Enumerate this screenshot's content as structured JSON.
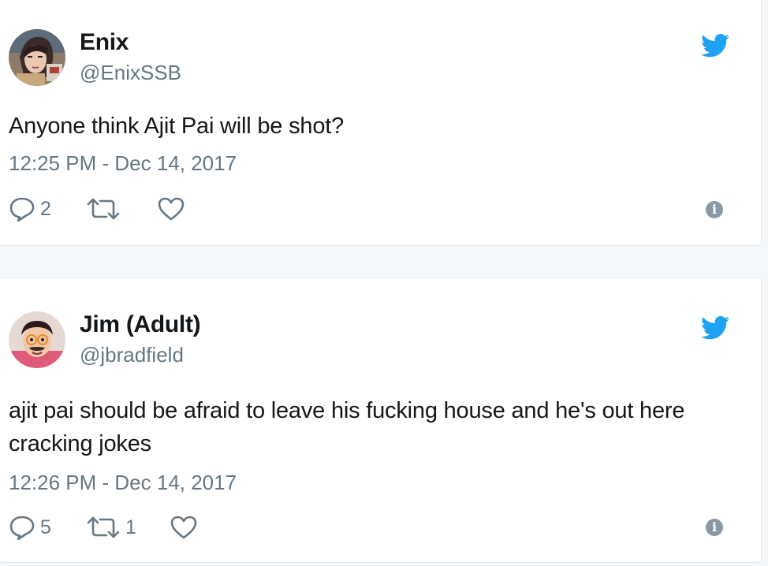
{
  "colors": {
    "twitter_blue": "#1da1f2",
    "secondary_text": "#657786",
    "primary_text": "#14171a",
    "border": "#e1e8ed"
  },
  "tweets": [
    {
      "display_name": "Enix",
      "handle": "@EnixSSB",
      "text": "Anyone think Ajit Pai will be shot?",
      "timestamp": "12:25 PM - Dec 14, 2017",
      "replies": "2",
      "retweets": "",
      "likes": "",
      "icons": [
        "reply-icon",
        "retweet-icon",
        "like-icon",
        "info-icon",
        "twitter-bird-icon"
      ]
    },
    {
      "display_name": "Jim (Adult)",
      "handle": "@jbradfield",
      "text": "ajit pai should be afraid to leave his fucking house and he's out here cracking jokes",
      "timestamp": "12:26 PM - Dec 14, 2017",
      "replies": "5",
      "retweets": "1",
      "likes": "",
      "icons": [
        "reply-icon",
        "retweet-icon",
        "like-icon",
        "info-icon",
        "twitter-bird-icon"
      ]
    }
  ]
}
